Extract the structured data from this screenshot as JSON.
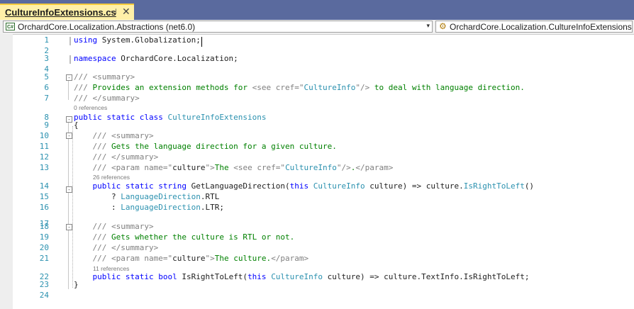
{
  "tab": {
    "title": "CultureInfoExtensions.cs",
    "pin": "⊣",
    "close": "✕"
  },
  "navbar": {
    "project_icon": "C#",
    "project": "OrchardCore.Localization.Abstractions (net6.0)",
    "type_icon": "class-icon",
    "type": "OrchardCore.Localization.CultureInfoExtensions"
  },
  "colors": {
    "keyword": "#0000ff",
    "type": "#2b91af",
    "comment": "#008000",
    "doc_tag": "#808080",
    "line_number": "#2b91af",
    "lens": "#7a7a7a"
  },
  "code_lenses": [
    "0 references",
    "26 references",
    "11 references"
  ],
  "lines": [
    {
      "n": "1",
      "segs": [
        {
          "c": "kw",
          "t": "using"
        },
        {
          "c": "",
          "t": " System.Globalization;"
        }
      ]
    },
    {
      "n": "2",
      "segs": []
    },
    {
      "n": "3",
      "segs": [
        {
          "c": "kw",
          "t": "namespace"
        },
        {
          "c": "",
          "t": " OrchardCore.Localization;"
        }
      ]
    },
    {
      "n": "4",
      "segs": []
    },
    {
      "n": "5",
      "segs": [
        {
          "c": "cd",
          "t": "/// <summary>"
        }
      ]
    },
    {
      "n": "6",
      "segs": [
        {
          "c": "cd",
          "t": "///"
        },
        {
          "c": "cm",
          "t": " Provides an extension methods for "
        },
        {
          "c": "cd",
          "t": "<see cref=\""
        },
        {
          "c": "ty",
          "t": "CultureInfo"
        },
        {
          "c": "cd",
          "t": "\"/>"
        },
        {
          "c": "cm",
          "t": " to deal with language direction."
        }
      ]
    },
    {
      "n": "7",
      "segs": [
        {
          "c": "cd",
          "t": "/// </summary>"
        }
      ]
    },
    {
      "n": "8",
      "segs": [
        {
          "c": "kw",
          "t": "public static class"
        },
        {
          "c": "",
          "t": " "
        },
        {
          "c": "ty",
          "t": "CultureInfoExtensions"
        }
      ]
    },
    {
      "n": "9",
      "segs": [
        {
          "c": "",
          "t": "{"
        }
      ]
    },
    {
      "n": "10",
      "segs": [
        {
          "c": "",
          "t": "    "
        },
        {
          "c": "cd",
          "t": "/// <summary>"
        }
      ]
    },
    {
      "n": "11",
      "segs": [
        {
          "c": "",
          "t": "    "
        },
        {
          "c": "cd",
          "t": "///"
        },
        {
          "c": "cm",
          "t": " Gets the language direction for a given culture."
        }
      ]
    },
    {
      "n": "12",
      "segs": [
        {
          "c": "",
          "t": "    "
        },
        {
          "c": "cd",
          "t": "/// </summary>"
        }
      ]
    },
    {
      "n": "13",
      "segs": [
        {
          "c": "",
          "t": "    "
        },
        {
          "c": "cd",
          "t": "/// <param name=\""
        },
        {
          "c": "",
          "t": "culture"
        },
        {
          "c": "cd",
          "t": "\">"
        },
        {
          "c": "cm",
          "t": "The "
        },
        {
          "c": "cd",
          "t": "<see cref=\""
        },
        {
          "c": "ty",
          "t": "CultureInfo"
        },
        {
          "c": "cd",
          "t": "\"/>"
        },
        {
          "c": "cm",
          "t": "."
        },
        {
          "c": "cd",
          "t": "</param>"
        }
      ]
    },
    {
      "n": "14",
      "segs": [
        {
          "c": "",
          "t": "    "
        },
        {
          "c": "kw",
          "t": "public static string"
        },
        {
          "c": "",
          "t": " GetLanguageDirection("
        },
        {
          "c": "kw",
          "t": "this"
        },
        {
          "c": "",
          "t": " "
        },
        {
          "c": "ty",
          "t": "CultureInfo"
        },
        {
          "c": "",
          "t": " culture) => culture."
        },
        {
          "c": "ty",
          "t": "IsRightToLeft"
        },
        {
          "c": "",
          "t": "()"
        }
      ]
    },
    {
      "n": "15",
      "segs": [
        {
          "c": "",
          "t": "        ? "
        },
        {
          "c": "ty",
          "t": "LanguageDirection"
        },
        {
          "c": "",
          "t": ".RTL"
        }
      ]
    },
    {
      "n": "16",
      "segs": [
        {
          "c": "",
          "t": "        : "
        },
        {
          "c": "ty",
          "t": "LanguageDirection"
        },
        {
          "c": "",
          "t": ".LTR;"
        }
      ]
    },
    {
      "n": "17",
      "segs": []
    },
    {
      "n": "18",
      "segs": [
        {
          "c": "",
          "t": "    "
        },
        {
          "c": "cd",
          "t": "/// <summary>"
        }
      ]
    },
    {
      "n": "19",
      "segs": [
        {
          "c": "",
          "t": "    "
        },
        {
          "c": "cd",
          "t": "///"
        },
        {
          "c": "cm",
          "t": " Gets whether the culture is RTL or not."
        }
      ]
    },
    {
      "n": "20",
      "segs": [
        {
          "c": "",
          "t": "    "
        },
        {
          "c": "cd",
          "t": "/// </summary>"
        }
      ]
    },
    {
      "n": "21",
      "segs": [
        {
          "c": "",
          "t": "    "
        },
        {
          "c": "cd",
          "t": "/// <param name=\""
        },
        {
          "c": "",
          "t": "culture"
        },
        {
          "c": "cd",
          "t": "\">"
        },
        {
          "c": "cm",
          "t": "The culture."
        },
        {
          "c": "cd",
          "t": "</param>"
        }
      ]
    },
    {
      "n": "22",
      "segs": [
        {
          "c": "",
          "t": "    "
        },
        {
          "c": "kw",
          "t": "public static bool"
        },
        {
          "c": "",
          "t": " IsRightToLeft("
        },
        {
          "c": "kw",
          "t": "this"
        },
        {
          "c": "",
          "t": " "
        },
        {
          "c": "ty",
          "t": "CultureInfo"
        },
        {
          "c": "",
          "t": " culture) => culture.TextInfo.IsRightToLeft;"
        }
      ]
    },
    {
      "n": "23",
      "segs": [
        {
          "c": "",
          "t": "}"
        }
      ]
    },
    {
      "n": "24",
      "segs": []
    }
  ]
}
